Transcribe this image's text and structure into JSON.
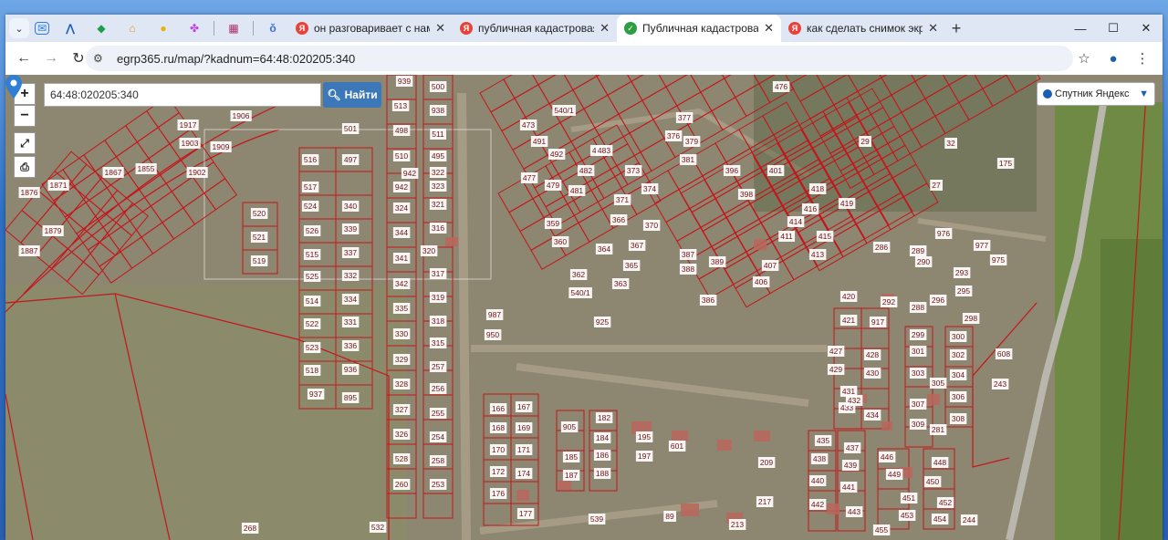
{
  "browser": {
    "tabs": [
      {
        "title": "он разговаривает с нами пере",
        "favicon": "yandex-icon",
        "active": false
      },
      {
        "title": "публичная кадастровая карта",
        "favicon": "yandex-icon",
        "active": false
      },
      {
        "title": "Публичная кадастровая карта",
        "favicon": "check-icon",
        "active": true
      },
      {
        "title": "как сделать снимок экрана на",
        "favicon": "yandex-icon",
        "active": false
      }
    ],
    "url": "egrp365.ru/map/?kadnum=64:48:020205:340",
    "window_controls": {
      "minimize": "—",
      "maximize": "☐",
      "close": "✕"
    }
  },
  "map": {
    "search_value": "64:48:020205:340",
    "search_button": "Найти",
    "layer_option": "Спутник Яндекс",
    "zoom_in": "+",
    "zoom_out": "−",
    "parcels": [
      {
        "label": "939"
      },
      {
        "label": "500"
      },
      {
        "label": "513"
      },
      {
        "label": "938"
      },
      {
        "label": "501"
      },
      {
        "label": "498"
      },
      {
        "label": "511"
      },
      {
        "label": "516"
      },
      {
        "label": "497"
      },
      {
        "label": "510"
      },
      {
        "label": "495"
      },
      {
        "label": "942"
      },
      {
        "label": "322"
      },
      {
        "label": "517"
      },
      {
        "label": "942"
      },
      {
        "label": "323"
      },
      {
        "label": "524"
      },
      {
        "label": "340"
      },
      {
        "label": "324"
      },
      {
        "label": "321"
      },
      {
        "label": "520"
      },
      {
        "label": "526"
      },
      {
        "label": "339"
      },
      {
        "label": "344"
      },
      {
        "label": "316"
      },
      {
        "label": "521"
      },
      {
        "label": "515"
      },
      {
        "label": "337"
      },
      {
        "label": "320"
      },
      {
        "label": "519"
      },
      {
        "label": "341"
      },
      {
        "label": "525"
      },
      {
        "label": "332"
      },
      {
        "label": "317"
      },
      {
        "label": "342"
      },
      {
        "label": "514"
      },
      {
        "label": "334"
      },
      {
        "label": "319"
      },
      {
        "label": "335"
      },
      {
        "label": "522"
      },
      {
        "label": "331"
      },
      {
        "label": "318"
      },
      {
        "label": "523"
      },
      {
        "label": "336"
      },
      {
        "label": "330"
      },
      {
        "label": "315"
      },
      {
        "label": "518"
      },
      {
        "label": "936"
      },
      {
        "label": "329"
      },
      {
        "label": "257"
      },
      {
        "label": "937"
      },
      {
        "label": "895"
      },
      {
        "label": "328"
      },
      {
        "label": "256"
      },
      {
        "label": "327"
      },
      {
        "label": "255"
      },
      {
        "label": "326"
      },
      {
        "label": "254"
      },
      {
        "label": "528"
      },
      {
        "label": "258"
      },
      {
        "label": "260"
      },
      {
        "label": "253"
      },
      {
        "label": "532"
      },
      {
        "label": "268"
      },
      {
        "label": "1917"
      },
      {
        "label": "1903"
      },
      {
        "label": "1902"
      },
      {
        "label": "1855"
      },
      {
        "label": "1867"
      },
      {
        "label": "1871"
      },
      {
        "label": "1876"
      },
      {
        "label": "1879"
      },
      {
        "label": "1887"
      },
      {
        "label": "1909"
      },
      {
        "label": "1906"
      },
      {
        "label": "540/1"
      },
      {
        "label": "484"
      },
      {
        "label": "482"
      },
      {
        "label": "481"
      },
      {
        "label": "479"
      },
      {
        "label": "477"
      },
      {
        "label": "373"
      },
      {
        "label": "374"
      },
      {
        "label": "371"
      },
      {
        "label": "366"
      },
      {
        "label": "370"
      },
      {
        "label": "367"
      },
      {
        "label": "364"
      },
      {
        "label": "365"
      },
      {
        "label": "363"
      },
      {
        "label": "362"
      },
      {
        "label": "360"
      },
      {
        "label": "359"
      },
      {
        "label": "925"
      },
      {
        "label": "987"
      },
      {
        "label": "950"
      },
      {
        "label": "540/1"
      },
      {
        "label": "401"
      },
      {
        "label": "398"
      },
      {
        "label": "396"
      },
      {
        "label": "416"
      },
      {
        "label": "418"
      },
      {
        "label": "419"
      },
      {
        "label": "414"
      },
      {
        "label": "411"
      },
      {
        "label": "415"
      },
      {
        "label": "413"
      },
      {
        "label": "407"
      },
      {
        "label": "406"
      },
      {
        "label": "388"
      },
      {
        "label": "387"
      },
      {
        "label": "389"
      },
      {
        "label": "386"
      },
      {
        "label": "420"
      },
      {
        "label": "421"
      },
      {
        "label": "427"
      },
      {
        "label": "429"
      },
      {
        "label": "431"
      },
      {
        "label": "433"
      },
      {
        "label": "428"
      },
      {
        "label": "430"
      },
      {
        "label": "432"
      },
      {
        "label": "434"
      },
      {
        "label": "917"
      },
      {
        "label": "292"
      },
      {
        "label": "288"
      },
      {
        "label": "286"
      },
      {
        "label": "289"
      },
      {
        "label": "290"
      },
      {
        "label": "976"
      },
      {
        "label": "977"
      },
      {
        "label": "975"
      },
      {
        "label": "293"
      },
      {
        "label": "295"
      },
      {
        "label": "296"
      },
      {
        "label": "298"
      },
      {
        "label": "299"
      },
      {
        "label": "300"
      },
      {
        "label": "301"
      },
      {
        "label": "302"
      },
      {
        "label": "303"
      },
      {
        "label": "304"
      },
      {
        "label": "305"
      },
      {
        "label": "306"
      },
      {
        "label": "307"
      },
      {
        "label": "308"
      },
      {
        "label": "309"
      },
      {
        "label": "281"
      },
      {
        "label": "608"
      },
      {
        "label": "243"
      },
      {
        "label": "244"
      },
      {
        "label": "446"
      },
      {
        "label": "448"
      },
      {
        "label": "449"
      },
      {
        "label": "450"
      },
      {
        "label": "451"
      },
      {
        "label": "452"
      },
      {
        "label": "453"
      },
      {
        "label": "454"
      },
      {
        "label": "455"
      },
      {
        "label": "435"
      },
      {
        "label": "437"
      },
      {
        "label": "438"
      },
      {
        "label": "439"
      },
      {
        "label": "440"
      },
      {
        "label": "441"
      },
      {
        "label": "442"
      },
      {
        "label": "443"
      },
      {
        "label": "905"
      },
      {
        "label": "182"
      },
      {
        "label": "184"
      },
      {
        "label": "185"
      },
      {
        "label": "186"
      },
      {
        "label": "187"
      },
      {
        "label": "188"
      },
      {
        "label": "195"
      },
      {
        "label": "197"
      },
      {
        "label": "601"
      },
      {
        "label": "209"
      },
      {
        "label": "217"
      },
      {
        "label": "213"
      },
      {
        "label": "539"
      },
      {
        "label": "89"
      },
      {
        "label": "166"
      },
      {
        "label": "167"
      },
      {
        "label": "168"
      },
      {
        "label": "169"
      },
      {
        "label": "170"
      },
      {
        "label": "171"
      },
      {
        "label": "172"
      },
      {
        "label": "174"
      },
      {
        "label": "176"
      },
      {
        "label": "177"
      },
      {
        "label": "473"
      },
      {
        "label": "491"
      },
      {
        "label": "492"
      },
      {
        "label": "483"
      },
      {
        "label": "376"
      },
      {
        "label": "377"
      },
      {
        "label": "379"
      },
      {
        "label": "381"
      },
      {
        "label": "32"
      },
      {
        "label": "29"
      },
      {
        "label": "27"
      },
      {
        "label": "175"
      },
      {
        "label": "476"
      }
    ]
  }
}
